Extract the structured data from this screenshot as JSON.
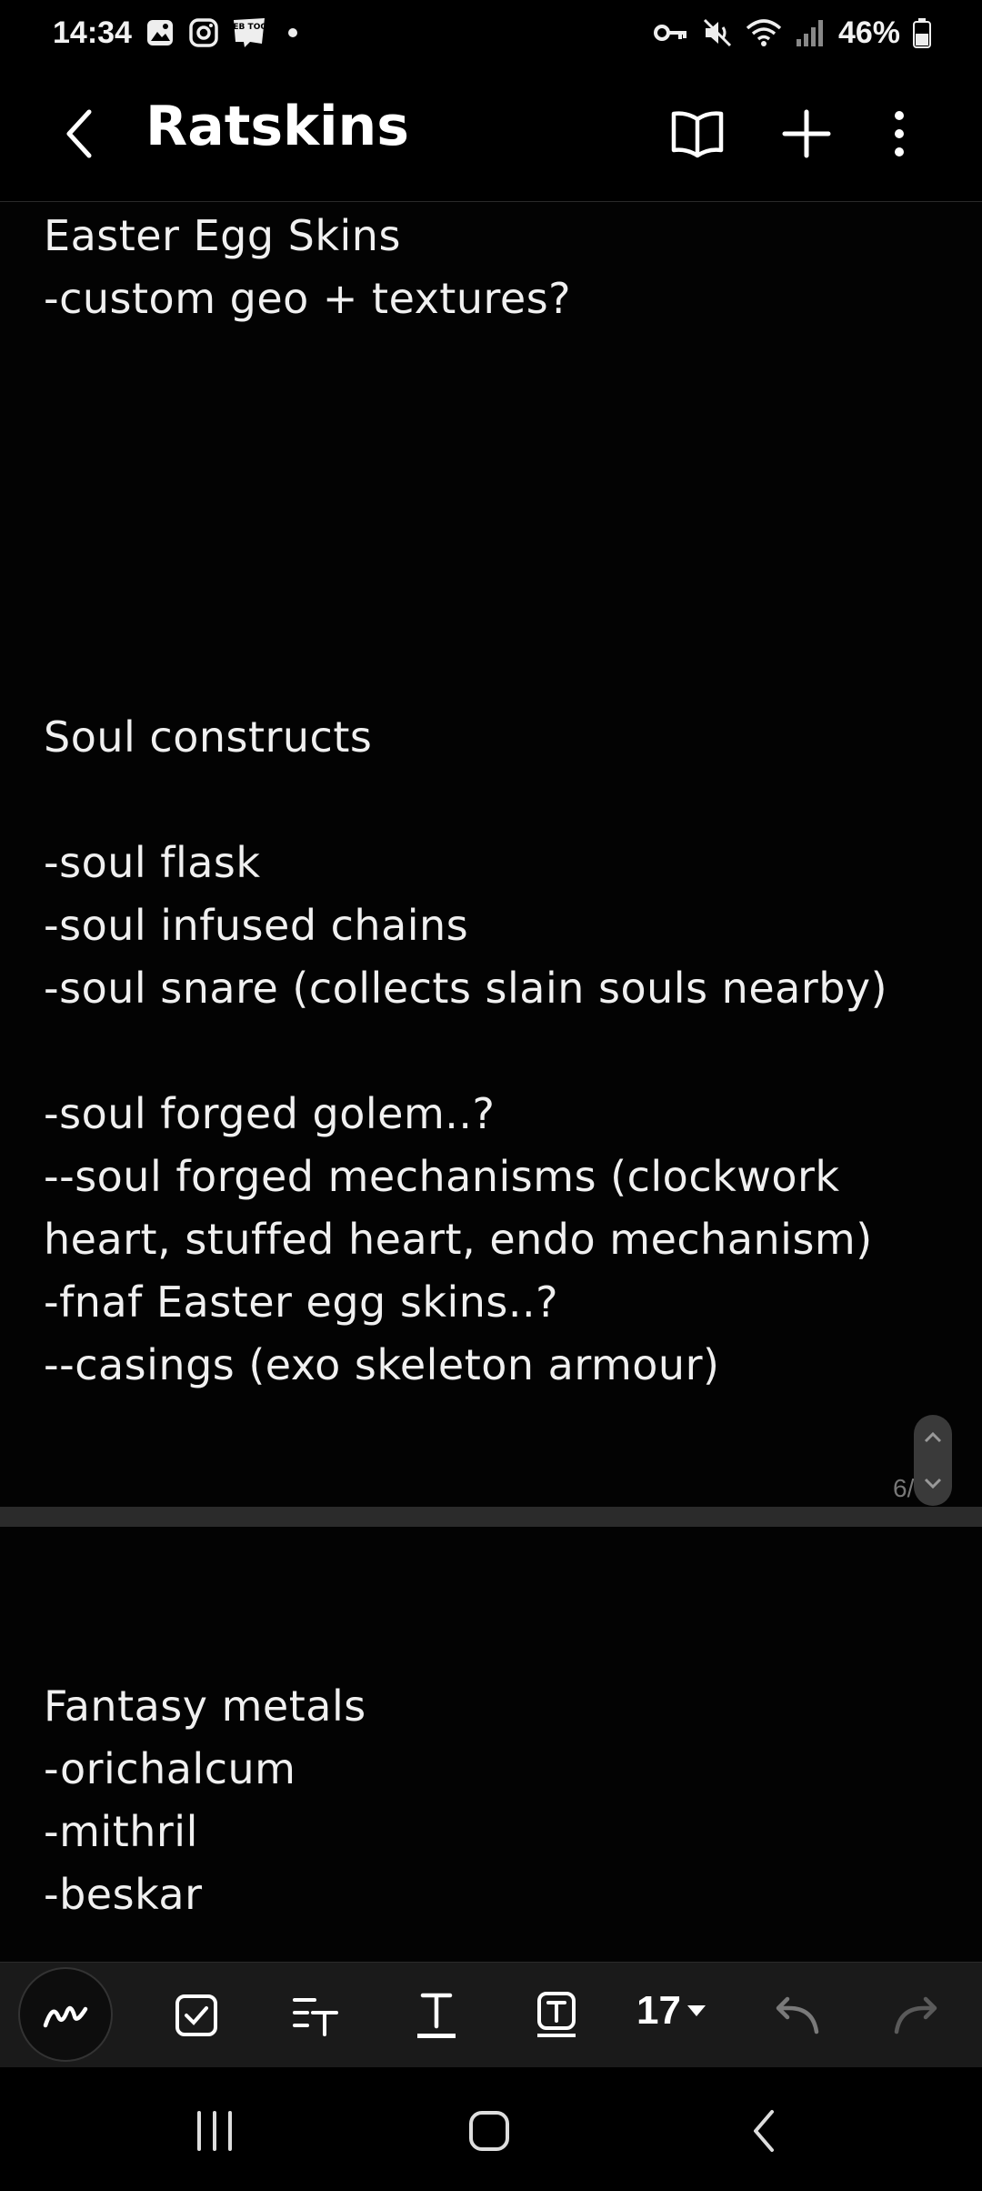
{
  "status_bar": {
    "time": "14:34",
    "battery": "46%",
    "icons": [
      "gallery-icon",
      "instagram-icon",
      "webtoon-icon",
      "dot-icon",
      "vpn-key-icon",
      "mute-icon",
      "wifi-icon",
      "signal-icon",
      "battery-icon"
    ],
    "webtoon_label": "WEB TOON"
  },
  "app_bar": {
    "title": "Ratskins",
    "icons": [
      "back-icon",
      "book-view-icon",
      "add-icon",
      "more-icon"
    ]
  },
  "page1": {
    "lines": [
      "Easter Egg Skins",
      "-custom geo + textures?",
      "Soul constructs",
      "-soul flask",
      "-soul infused chains",
      "-soul snare (collects slain souls nearby)",
      "-soul forged golem..?",
      "--soul forged mechanisms (clockwork",
      "heart, stuffed heart, endo mechanism)",
      "-fnaf Easter egg skins..?",
      "--casings (exo skeleton armour)"
    ]
  },
  "page_indicator": "6/8",
  "page2": {
    "lines": [
      "Fantasy metals",
      "-orichalcum",
      "-mithril",
      "-beskar"
    ]
  },
  "toolbar": {
    "font_size": "17",
    "icons": [
      "pen-icon",
      "checkbox-icon",
      "text-style-icon",
      "underline-text-icon",
      "text-box-icon",
      "dropdown-icon",
      "undo-icon",
      "redo-icon"
    ]
  },
  "nav_bar": {
    "icons": [
      "recents-icon",
      "home-icon",
      "nav-back-icon"
    ]
  },
  "colors": {
    "background": "#000000",
    "toolbar": "#1a1a1a",
    "text": "#f0f0f0",
    "separator": "#2b2b2b"
  }
}
